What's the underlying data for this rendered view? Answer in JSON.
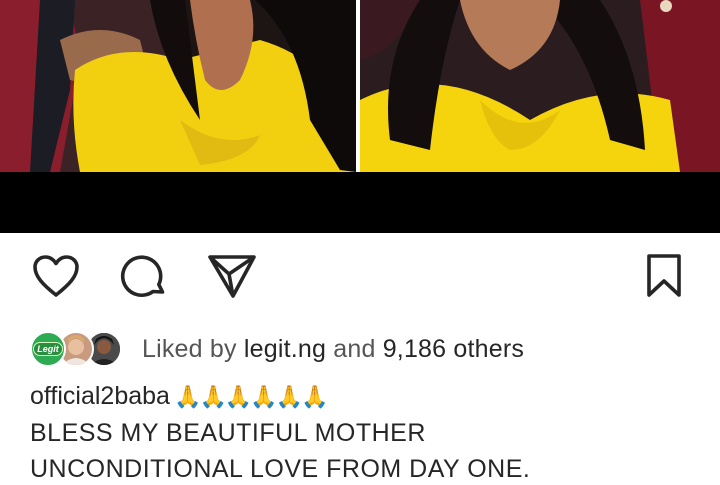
{
  "post": {
    "image_alt": "Two photos of a woman with curly hair in a yellow top"
  },
  "actions": {
    "like_icon": "heart-icon",
    "comment_icon": "comment-bubble-icon",
    "share_icon": "paper-plane-icon",
    "save_icon": "bookmark-icon"
  },
  "likes": {
    "prefix": "Liked by ",
    "user": "legit.ng",
    "middle": " and ",
    "count": "9,186 others",
    "avatar1_label": "Legit"
  },
  "caption": {
    "username": "official2baba",
    "emojis": " 🙏🙏🙏🙏🙏🙏",
    "line1": "BLESS MY BEAUTIFUL MOTHER",
    "line2": "UNCONDITIONAL LOVE FROM DAY ONE."
  }
}
